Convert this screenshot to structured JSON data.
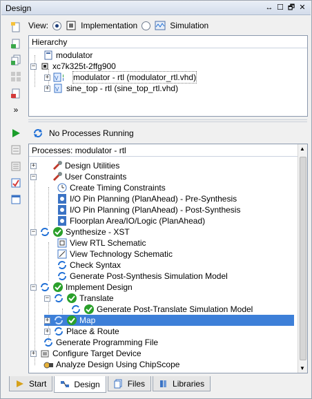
{
  "window": {
    "title": "Design",
    "controls": [
      "↔",
      "☐",
      "🗗",
      "✕"
    ]
  },
  "view": {
    "label": "View:",
    "options": [
      {
        "label": "Implementation",
        "selected": true
      },
      {
        "label": "Simulation",
        "selected": false
      }
    ]
  },
  "hierarchy": {
    "header": "Hierarchy",
    "items": [
      {
        "label": "modulator"
      },
      {
        "label": "xc7k325t-2ffg900"
      },
      {
        "label": "modulator - rtl (modulator_rtl.vhd)"
      },
      {
        "label": "sine_top - rtl (sine_top_rtl.vhd)"
      }
    ]
  },
  "status": {
    "text": "No Processes Running"
  },
  "processes": {
    "header": "Processes: modulator - rtl",
    "items": [
      {
        "label": "Design Utilities"
      },
      {
        "label": "User Constraints"
      },
      {
        "label": "Create Timing Constraints"
      },
      {
        "label": "I/O Pin Planning (PlanAhead) - Pre-Synthesis"
      },
      {
        "label": "I/O Pin Planning (PlanAhead) - Post-Synthesis"
      },
      {
        "label": "Floorplan Area/IO/Logic (PlanAhead)"
      },
      {
        "label": "Synthesize - XST"
      },
      {
        "label": "View RTL Schematic"
      },
      {
        "label": "View Technology Schematic"
      },
      {
        "label": "Check Syntax"
      },
      {
        "label": "Generate Post-Synthesis Simulation Model"
      },
      {
        "label": "Implement Design"
      },
      {
        "label": "Translate"
      },
      {
        "label": "Generate Post-Translate Simulation Model"
      },
      {
        "label": "Map"
      },
      {
        "label": "Place & Route"
      },
      {
        "label": "Generate Programming File"
      },
      {
        "label": "Configure Target Device"
      },
      {
        "label": "Analyze Design Using ChipScope"
      }
    ]
  },
  "tabs": [
    {
      "label": "Start",
      "active": false
    },
    {
      "label": "Design",
      "active": true
    },
    {
      "label": "Files",
      "active": false
    },
    {
      "label": "Libraries",
      "active": false
    }
  ],
  "colors": {
    "selection": "#3d7fd8",
    "success": "#2aa02a",
    "refresh": "#1f6fd6",
    "run": "#1b9e2b"
  }
}
